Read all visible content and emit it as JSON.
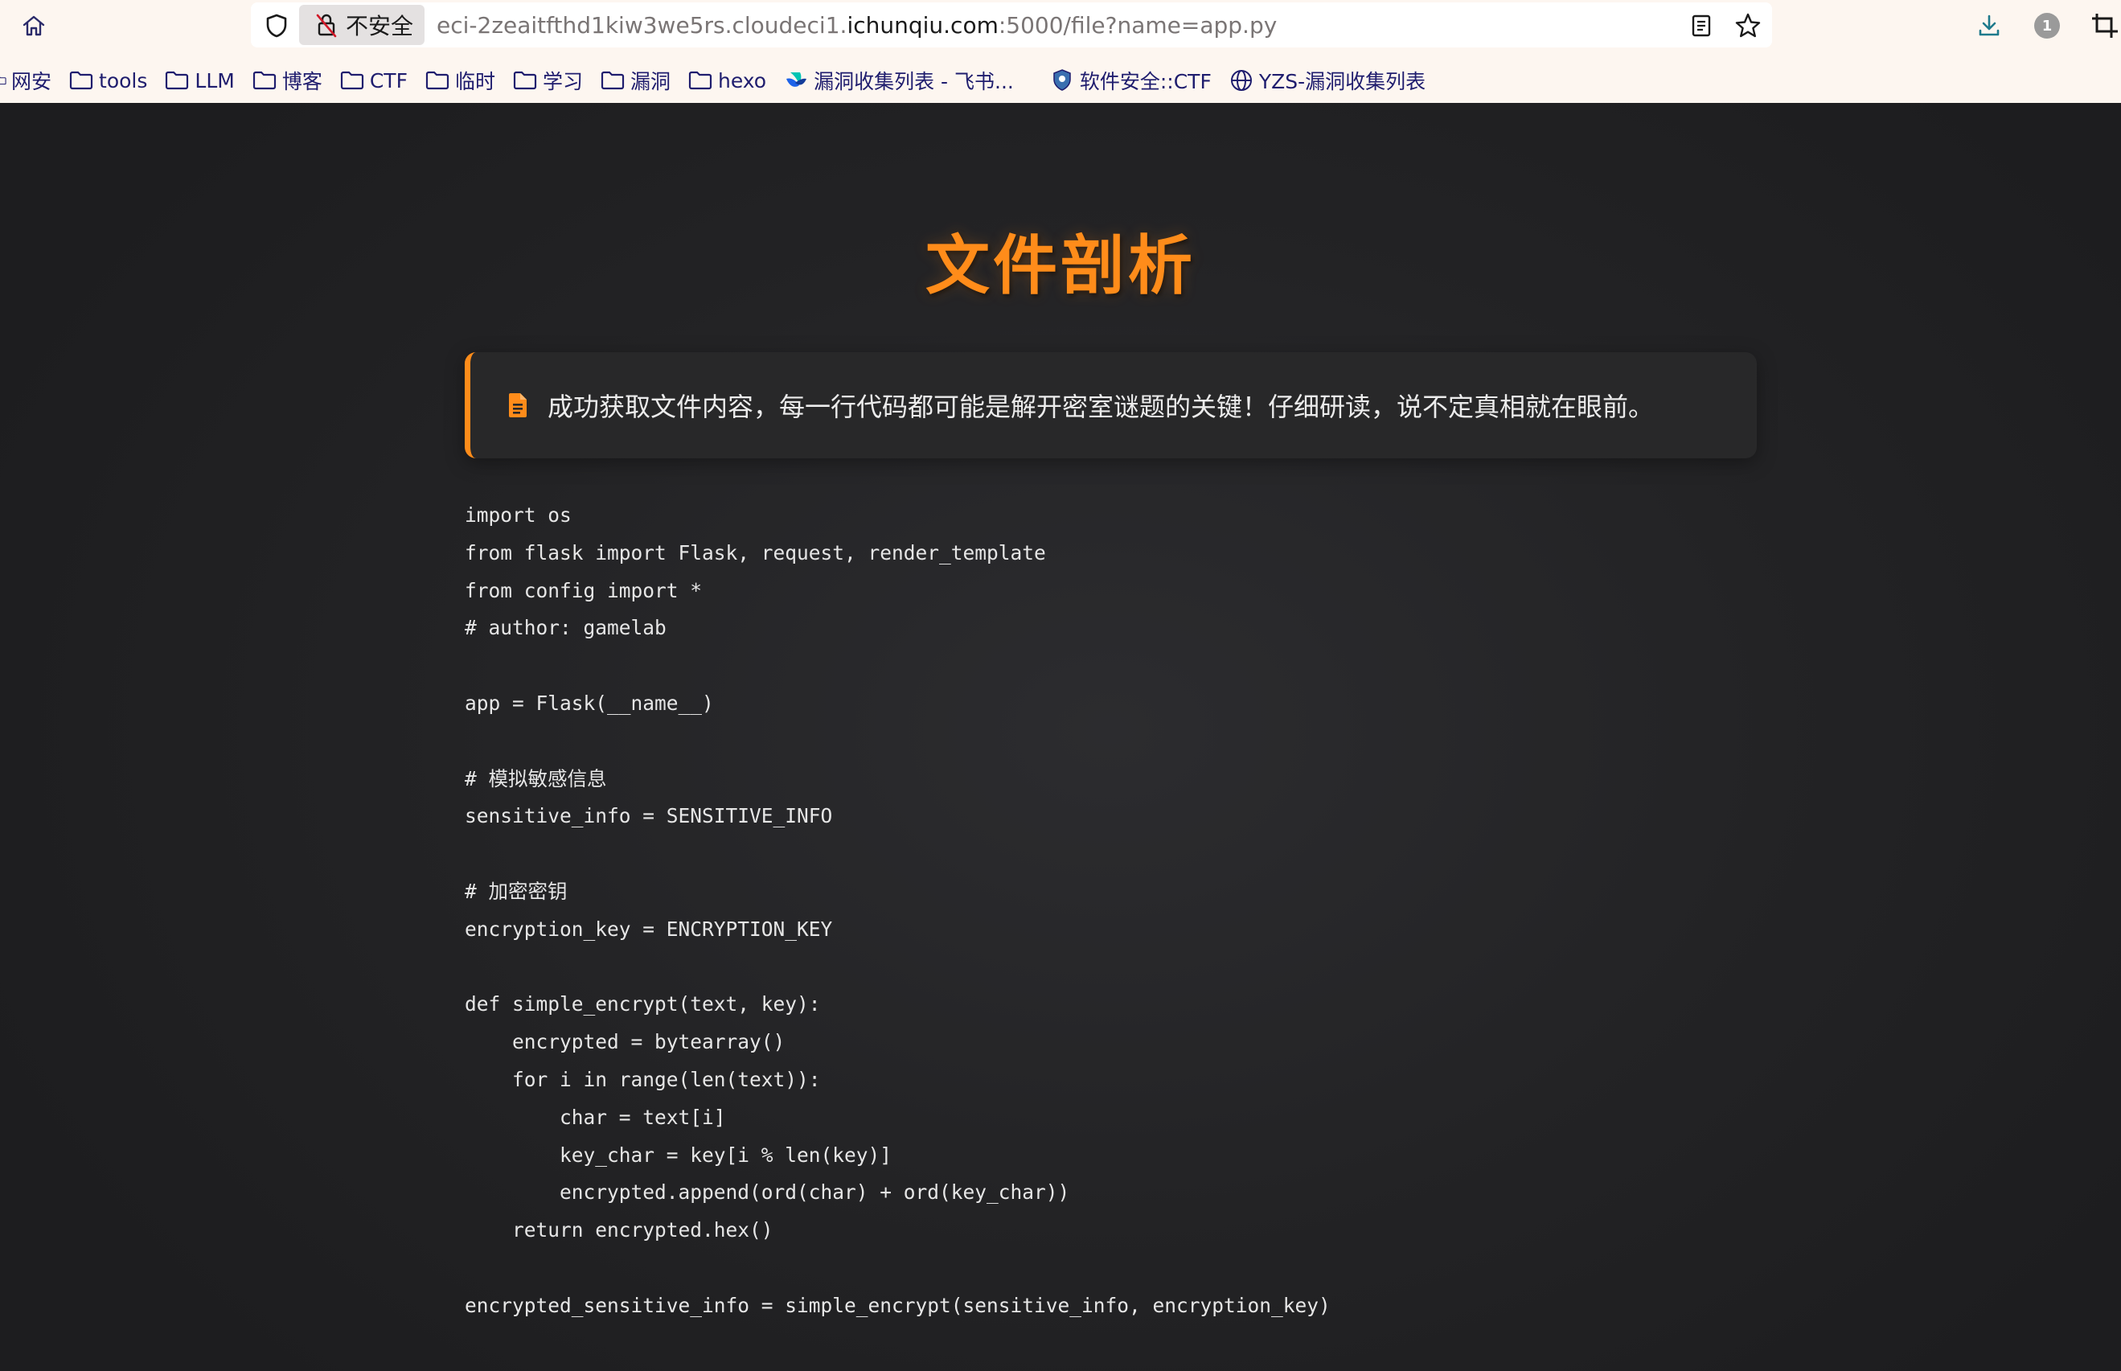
{
  "browser": {
    "security_label": "不安全",
    "url_prefix": "eci-2zeaitfthd1kiw3we5rs.cloudeci1.",
    "url_domain": "ichunqiu.com",
    "url_suffix": ":5000/file?name=app.py",
    "badge_count": "1",
    "bookmarks": [
      {
        "label": "网安",
        "icon": "folder-icon"
      },
      {
        "label": "tools",
        "icon": "folder-icon"
      },
      {
        "label": "LLM",
        "icon": "folder-icon"
      },
      {
        "label": "博客",
        "icon": "folder-icon"
      },
      {
        "label": "CTF",
        "icon": "folder-icon"
      },
      {
        "label": "临时",
        "icon": "folder-icon"
      },
      {
        "label": "学习",
        "icon": "folder-icon"
      },
      {
        "label": "漏洞",
        "icon": "folder-icon"
      },
      {
        "label": "hexo",
        "icon": "folder-icon"
      },
      {
        "label": "漏洞收集列表 - 飞书...",
        "icon": "feishu-icon"
      },
      {
        "label": "软件安全::CTF",
        "icon": "shield-badge-icon"
      },
      {
        "label": "YZS-漏洞收集列表",
        "icon": "globe-icon"
      }
    ]
  },
  "page": {
    "title": "文件剖析",
    "alert_message": "成功获取文件内容，每一行代码都可能是解开密室谜题的关键！仔细研读，说不定真相就在眼前。",
    "code": "import os\nfrom flask import Flask, request, render_template\nfrom config import *\n# author: gamelab\n\napp = Flask(__name__)\n\n# 模拟敏感信息\nsensitive_info = SENSITIVE_INFO\n\n# 加密密钥\nencryption_key = ENCRYPTION_KEY\n\ndef simple_encrypt(text, key):\n    encrypted = bytearray()\n    for i in range(len(text)):\n        char = text[i]\n        key_char = key[i % len(key)]\n        encrypted.append(ord(char) + ord(key_char))\n    return encrypted.hex()\n\nencrypted_sensitive_info = simple_encrypt(sensitive_info, encryption_key)"
  },
  "colors": {
    "accent": "#ff8c1a",
    "page_bg": "#1f1f21",
    "chrome_bg": "#fdf6f0"
  }
}
